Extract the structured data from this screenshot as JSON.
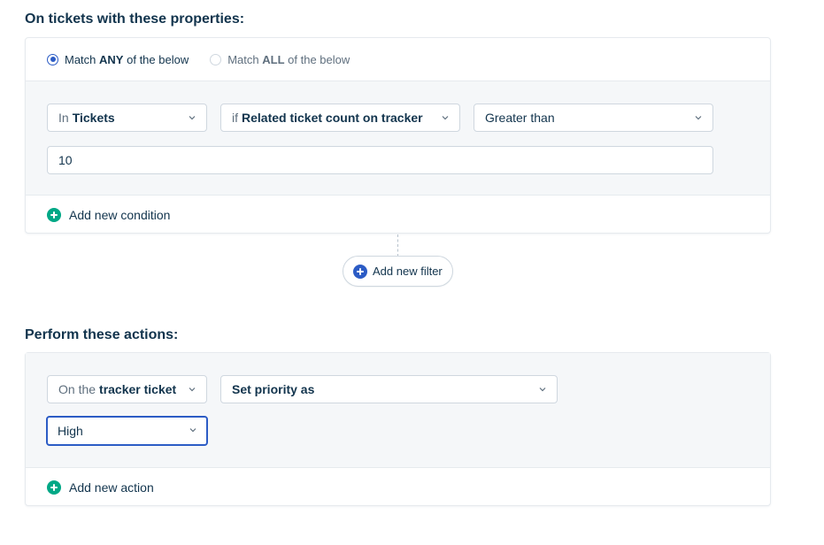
{
  "conditions_section": {
    "title": "On tickets with these properties:",
    "match_any": {
      "prefix": "Match",
      "bold": "ANY",
      "suffix": "of the below",
      "selected": true
    },
    "match_all": {
      "prefix": "Match",
      "bold": "ALL",
      "suffix": "of the below",
      "selected": false
    },
    "condition": {
      "scope": {
        "prefix": "In",
        "value": "Tickets"
      },
      "field": {
        "prefix": "if",
        "value": "Related ticket count on tracker"
      },
      "operator": {
        "value": "Greater than"
      },
      "input_value": "10"
    },
    "add_condition_label": "Add new condition"
  },
  "add_filter_label": "Add new filter",
  "actions_section": {
    "title": "Perform these actions:",
    "action": {
      "target": {
        "prefix": "On the",
        "value": "tracker ticket"
      },
      "action_type": {
        "value": "Set priority as"
      },
      "priority": {
        "value": "High"
      }
    },
    "add_action_label": "Add new action"
  },
  "colors": {
    "accent": "#2c5cc5",
    "add_icon": "#00a886",
    "text": "#12344d",
    "panel_bg": "#f5f7f9",
    "border": "#cfd7df"
  },
  "icons": {
    "dropdown": "chevron-down-icon",
    "add": "plus-circle-icon"
  }
}
